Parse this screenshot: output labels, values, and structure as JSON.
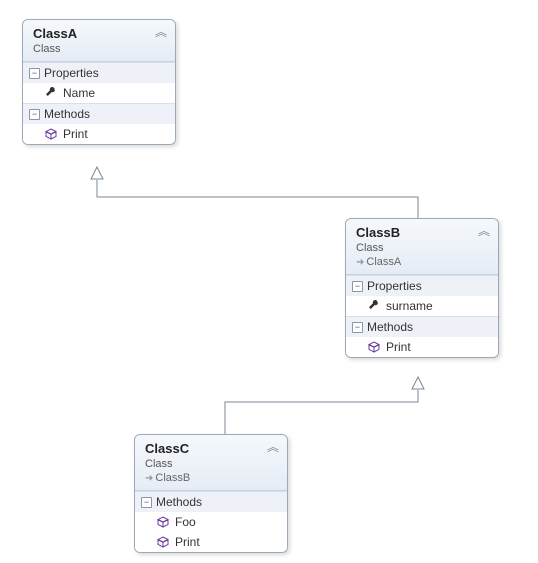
{
  "classA": {
    "title": "ClassA",
    "stereotype": "Class",
    "sections": {
      "properties": {
        "header": "Properties",
        "expand_glyph": "−",
        "items": [
          {
            "icon": "wrench",
            "name": "Name"
          }
        ]
      },
      "methods": {
        "header": "Methods",
        "expand_glyph": "−",
        "items": [
          {
            "icon": "cube",
            "name": "Print"
          }
        ]
      }
    }
  },
  "classB": {
    "title": "ClassB",
    "stereotype": "Class",
    "inherits": "ClassA",
    "sections": {
      "properties": {
        "header": "Properties",
        "expand_glyph": "−",
        "items": [
          {
            "icon": "wrench",
            "name": "surname"
          }
        ]
      },
      "methods": {
        "header": "Methods",
        "expand_glyph": "−",
        "items": [
          {
            "icon": "cube",
            "name": "Print"
          }
        ]
      }
    }
  },
  "classC": {
    "title": "ClassC",
    "stereotype": "Class",
    "inherits": "ClassB",
    "sections": {
      "methods": {
        "header": "Methods",
        "expand_glyph": "−",
        "items": [
          {
            "icon": "cube",
            "name": "Foo"
          },
          {
            "icon": "cube",
            "name": "Print"
          }
        ]
      }
    }
  },
  "colors": {
    "line": "#7a8796",
    "accent": "#6a3aa0"
  }
}
